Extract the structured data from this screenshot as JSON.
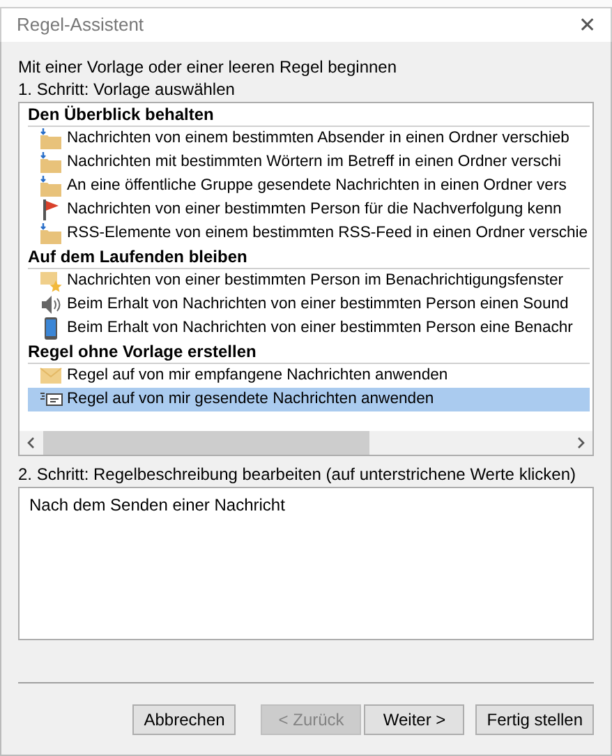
{
  "window": {
    "title": "Regel-Assistent",
    "close": "✕"
  },
  "intro": "Mit einer Vorlage oder einer leeren Regel beginnen",
  "step1": "1. Schritt: Vorlage auswählen",
  "groups": [
    {
      "title": "Den Überblick behalten",
      "items": [
        {
          "kind": "folder",
          "label": "Nachrichten von einem bestimmten Absender in einen Ordner verschieb",
          "selected": false
        },
        {
          "kind": "folder",
          "label": "Nachrichten mit bestimmten Wörtern im Betreff in einen Ordner verschi",
          "selected": false
        },
        {
          "kind": "folder",
          "label": "An eine öffentliche Gruppe gesendete Nachrichten in einen Ordner vers",
          "selected": false
        },
        {
          "kind": "flag",
          "label": "Nachrichten von einer bestimmten Person für die Nachverfolgung kenn",
          "selected": false
        },
        {
          "kind": "folder",
          "label": "RSS-Elemente von einem bestimmten RSS-Feed in einen Ordner verschie",
          "selected": false
        }
      ]
    },
    {
      "title": "Auf dem Laufenden bleiben",
      "items": [
        {
          "kind": "alert",
          "label": "Nachrichten von einer bestimmten Person im Benachrichtigungsfenster",
          "selected": false
        },
        {
          "kind": "sound",
          "label": "Beim Erhalt von Nachrichten von einer bestimmten Person einen Sound",
          "selected": false
        },
        {
          "kind": "phone",
          "label": "Beim Erhalt von Nachrichten von einer bestimmten Person eine Benachr",
          "selected": false
        }
      ]
    },
    {
      "title": "Regel ohne Vorlage erstellen",
      "items": [
        {
          "kind": "mail",
          "label": "Regel auf von mir empfangene Nachrichten anwenden",
          "selected": false
        },
        {
          "kind": "sent",
          "label": "Regel auf von mir gesendete Nachrichten anwenden",
          "selected": true
        }
      ]
    }
  ],
  "step2": "2. Schritt: Regelbeschreibung bearbeiten (auf unterstrichene Werte klicken)",
  "description": "Nach dem Senden einer Nachricht",
  "buttons": [
    {
      "label": "Abbrechen",
      "disabled": false
    },
    {
      "label": "< Zurück",
      "disabled": true
    },
    {
      "label": "Weiter >",
      "disabled": false
    },
    {
      "label": "Fertig stellen",
      "disabled": false
    }
  ]
}
